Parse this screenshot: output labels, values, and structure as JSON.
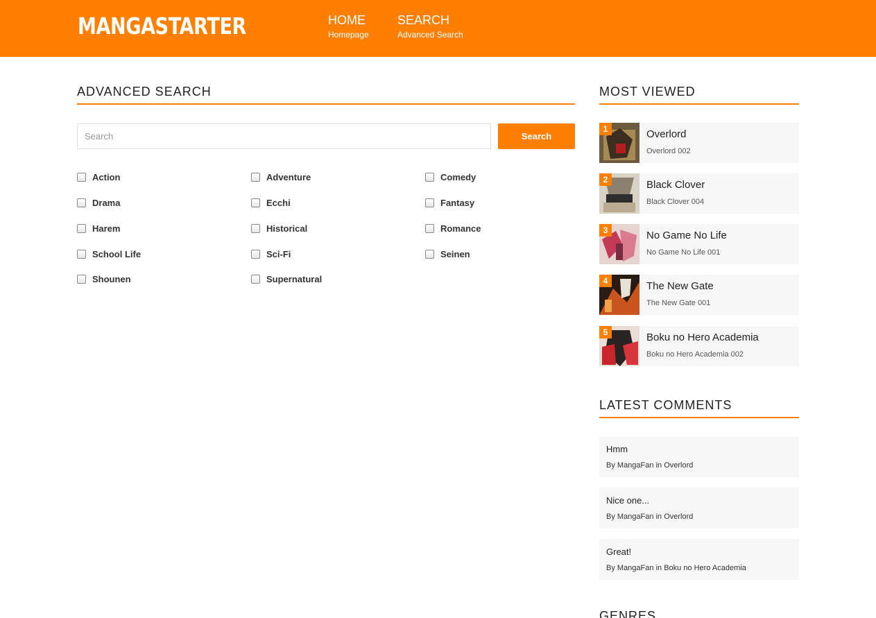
{
  "header": {
    "logo": "MANGASTARTER",
    "nav": [
      {
        "label": "HOME",
        "sub": "Homepage"
      },
      {
        "label": "SEARCH",
        "sub": "Advanced Search"
      }
    ]
  },
  "search": {
    "title": "ADVANCED SEARCH",
    "placeholder": "Search",
    "button": "Search",
    "genres": [
      "Action",
      "Adventure",
      "Comedy",
      "Drama",
      "Ecchi",
      "Fantasy",
      "Harem",
      "Historical",
      "Romance",
      "School Life",
      "Sci-Fi",
      "Seinen",
      "Shounen",
      "Supernatural"
    ]
  },
  "most_viewed": {
    "title": "MOST VIEWED",
    "items": [
      {
        "rank": "1",
        "title": "Overlord",
        "chapter": "Overlord 002"
      },
      {
        "rank": "2",
        "title": "Black Clover",
        "chapter": "Black Clover 004"
      },
      {
        "rank": "3",
        "title": "No Game No Life",
        "chapter": "No Game No Life 001"
      },
      {
        "rank": "4",
        "title": "The New Gate",
        "chapter": "The New Gate 001"
      },
      {
        "rank": "5",
        "title": "Boku no Hero Academia",
        "chapter": "Boku no Hero Academia 002"
      }
    ]
  },
  "latest_comments": {
    "title": "LATEST COMMENTS",
    "items": [
      {
        "text": "Hmm",
        "by": "By",
        "user": "MangaFan",
        "in": "in",
        "manga": "Overlord"
      },
      {
        "text": "Nice one...",
        "by": "By",
        "user": "MangaFan",
        "in": "in",
        "manga": "Overlord"
      },
      {
        "text": "Great!",
        "by": "By",
        "user": "MangaFan",
        "in": "in",
        "manga": "Boku no Hero Academia"
      }
    ]
  },
  "genres_section": {
    "title": "GENRES"
  },
  "colors": {
    "accent": "#ff7f00",
    "item_bg": "#f7f7f7"
  }
}
